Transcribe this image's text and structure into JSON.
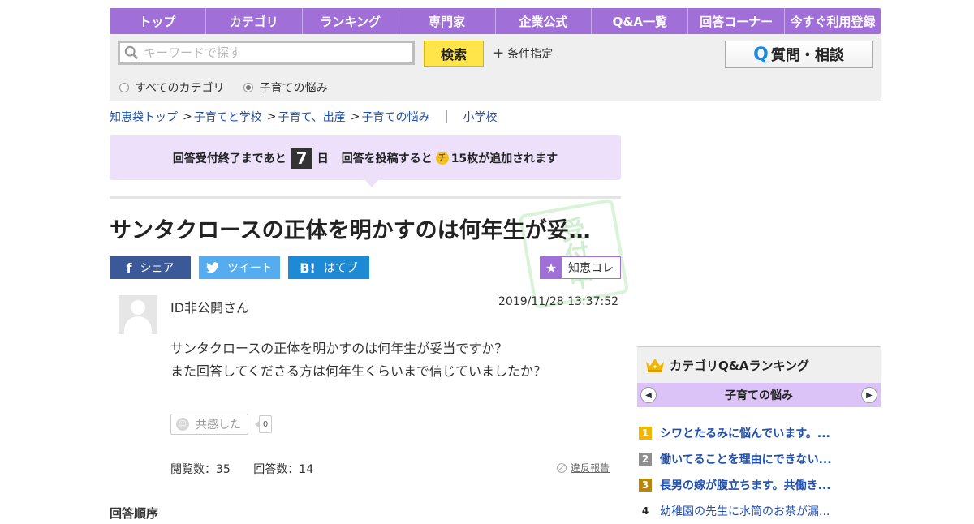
{
  "nav": [
    {
      "label": "トップ"
    },
    {
      "label": "カテゴリ"
    },
    {
      "label": "ランキング"
    },
    {
      "label": "専門家"
    },
    {
      "label": "企業公式"
    },
    {
      "label": "Q&A一覧"
    },
    {
      "label": "回答コーナー"
    },
    {
      "label": "今すぐ利用登録"
    }
  ],
  "search": {
    "placeholder": "キーワードで探す",
    "button": "検索",
    "condition": "条件指定",
    "ask_button": "質問・相談",
    "radios": [
      {
        "label": "すべてのカテゴリ",
        "selected": false
      },
      {
        "label": "子育ての悩み",
        "selected": true
      }
    ]
  },
  "breadcrumb": [
    "知恵袋トップ",
    "子育てと学校",
    "子育て、出産",
    "子育ての悩み"
  ],
  "breadcrumb_tag": "小学校",
  "notice": {
    "before_days": "回答受付終了まであと",
    "days": "7",
    "after_days": "日",
    "middle": "回答を投稿すると",
    "coin_icon": "チ",
    "reward": "15枚が追加されます"
  },
  "question": {
    "title": "サンタクロースの正体を明かすのは何年生が妥…",
    "stamp": "受付中",
    "user": "ID非公開さん",
    "date": "2019/11/28  13:37:52",
    "lines": [
      "サンタクロースの正体を明かすのは何年生が妥当ですか？",
      "また回答してくださる方は何年生くらいまで信じていましたか？"
    ],
    "empathy_label": "共感した",
    "empathy_count": "0",
    "views": "閲覧数：35",
    "answers": "回答数：14",
    "report": "違反報告"
  },
  "share": {
    "facebook": "シェア",
    "twitter": "ツイート",
    "hatena": "はてブ",
    "chiekore": "知恵コレ"
  },
  "ranking": {
    "title": "カテゴリQ&Aランキング",
    "category": "子育ての悩み",
    "items": [
      {
        "rank": "1",
        "text": "シワとたるみに悩んでいます。...",
        "color": "#f2b600"
      },
      {
        "rank": "2",
        "text": "働いてることを理由にできない...",
        "color": "#8e8e8e"
      },
      {
        "rank": "3",
        "text": "長男の嫁が腹立ちます。共働き...",
        "color": "#b8860b"
      },
      {
        "rank": "4",
        "text": "幼稚園の先生に水筒のお茶が漏...",
        "color": ""
      }
    ]
  },
  "cut_text": "回答順序"
}
